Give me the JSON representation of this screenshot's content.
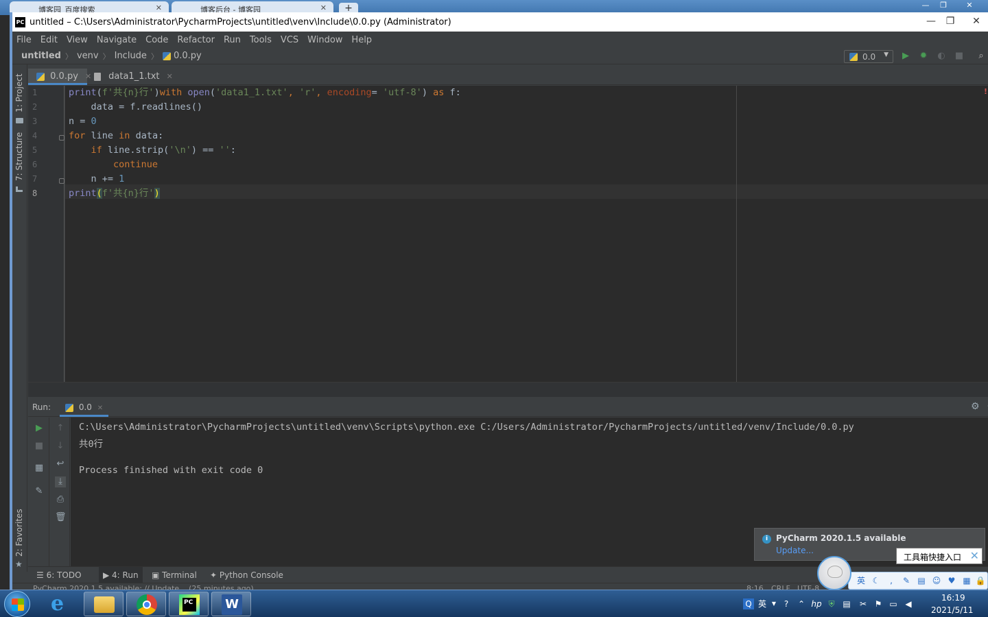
{
  "browser": {
    "tabs": [
      {
        "label": "博客园_百度搜索"
      },
      {
        "label": "博客后台 - 博客园"
      }
    ],
    "new_tab": "+"
  },
  "window": {
    "title": "untitled – C:\\Users\\Administrator\\PycharmProjects\\untitled\\venv\\Include\\0.0.py (Administrator)",
    "logo": "PC"
  },
  "menu": [
    "File",
    "Edit",
    "View",
    "Navigate",
    "Code",
    "Refactor",
    "Run",
    "Tools",
    "VCS",
    "Window",
    "Help"
  ],
  "breadcrumb": {
    "project": "untitled",
    "items": [
      "venv",
      "Include",
      "0.0.py"
    ]
  },
  "run_config": {
    "label": "0.0"
  },
  "side_tabs": {
    "project": "1: Project",
    "structure": "7: Structure",
    "favorites": "2: Favorites"
  },
  "editor_tabs": [
    {
      "label": "0.0.py",
      "active": true
    },
    {
      "label": "data1_1.txt",
      "active": false
    }
  ],
  "line_numbers": [
    "1",
    "2",
    "3",
    "4",
    "5",
    "6",
    "7",
    "8"
  ],
  "code_lines": [
    "print(f'共{n}行')with open('data1_1.txt', 'r', encoding= 'utf-8') as f:",
    "    data = f.readlines()",
    "n = 0",
    "for line in data:",
    "    if line.strip('\\n') == '':",
    "        continue",
    "    n += 1",
    "print(f'共{n}行')"
  ],
  "code_tokens": {
    "l1": {
      "print": "print",
      "fstr": "f'共{n}行'",
      "with": "with",
      "open": "open",
      "s1": "'data1_1.txt'",
      "s2": "'r'",
      "enc": "encoding",
      "s3": "'utf-8'",
      "as": "as",
      "f": "f:"
    },
    "l2": {
      "text": "    data = f.readlines()"
    },
    "l3": {
      "n": "n = ",
      "zero": "0"
    },
    "l4": {
      "for": "for",
      "line": " line ",
      "in": "in",
      "data": " data:"
    },
    "l5": {
      "if": "if",
      "strip": " line.strip(",
      "s": "'\\n'",
      "eq": ") == ",
      "e": "''",
      "colon": ":"
    },
    "l6": {
      "cont": "continue"
    },
    "l7": {
      "n": "    n += ",
      "one": "1"
    },
    "l8": {
      "print": "print",
      "lp": "(",
      "fstr": "f'共{n}行'",
      "rp": ")"
    }
  },
  "run_panel": {
    "label": "Run:",
    "tab": "0.0",
    "console": [
      "C:\\Users\\Administrator\\PycharmProjects\\untitled\\venv\\Scripts\\python.exe C:/Users/Administrator/PycharmProjects/untitled/venv/Include/0.0.py",
      "共0行",
      "",
      "Process finished with exit code 0"
    ]
  },
  "bottom_tabs": [
    {
      "label": "6: TODO"
    },
    {
      "label": "4: Run"
    },
    {
      "label": "Terminal"
    },
    {
      "label": "Python Console"
    }
  ],
  "status": {
    "message": "PyCharm 2020.1.5 available: // Update... (25 minutes ago)",
    "position": "8:16",
    "line_sep": "CRLF",
    "encoding": "UTF-8"
  },
  "notification": {
    "title": "PyCharm 2020.1.5 available",
    "link": "Update..."
  },
  "ime": {
    "tooltip": "工具箱快捷入口",
    "lang": "英"
  },
  "taskbar": {
    "tray_lang": "英",
    "time": "16:19",
    "date": "2021/5/11"
  },
  "colors": {
    "keyword": "#cc7832",
    "string": "#6a8759",
    "number": "#6897bb",
    "builtin": "#8888c6",
    "accent": "#4a88c7"
  }
}
